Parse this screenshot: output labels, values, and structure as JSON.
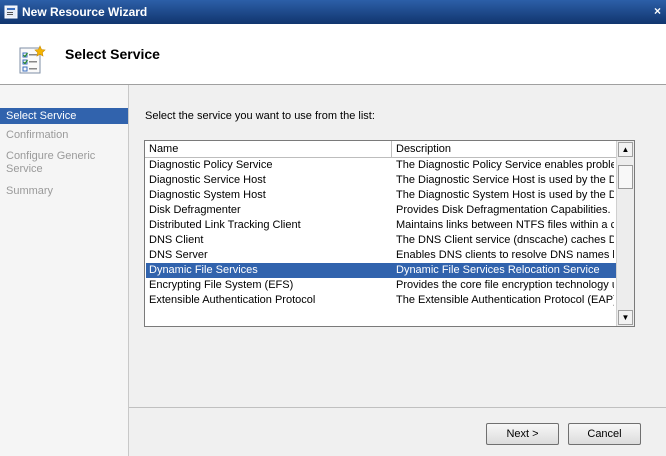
{
  "window": {
    "title": "New Resource Wizard",
    "close_label": "×"
  },
  "header": {
    "title": "Select Service"
  },
  "nav": {
    "items": [
      {
        "label": "Select Service",
        "active": true
      },
      {
        "label": "Confirmation",
        "active": false
      },
      {
        "label": "Configure Generic Service",
        "active": false
      },
      {
        "label": "Summary",
        "active": false
      }
    ]
  },
  "main": {
    "instruction": "Select the service you want to use from the list:",
    "columns": {
      "name": "Name",
      "description": "Description"
    },
    "services": [
      {
        "name": "Diagnostic Policy Service",
        "description": "The Diagnostic Policy Service enables problem ..."
      },
      {
        "name": "Diagnostic Service Host",
        "description": "The Diagnostic Service Host is used by the Dia..."
      },
      {
        "name": "Diagnostic System Host",
        "description": "The Diagnostic System Host is used by the Diag..."
      },
      {
        "name": "Disk Defragmenter",
        "description": "Provides Disk Defragmentation Capabilities."
      },
      {
        "name": "Distributed Link Tracking Client",
        "description": "Maintains links between NTFS files within a com..."
      },
      {
        "name": "DNS Client",
        "description": "The DNS Client service (dnscache) caches Do..."
      },
      {
        "name": "DNS Server",
        "description": "Enables DNS clients to resolve DNS names by ..."
      },
      {
        "name": "Dynamic File Services",
        "description": "Dynamic File Services Relocation Service"
      },
      {
        "name": "Encrypting File System (EFS)",
        "description": "Provides the core file encryption technology use..."
      },
      {
        "name": "Extensible Authentication Protocol",
        "description": "The Extensible Authentication Protocol (EAP) se..."
      }
    ],
    "selected_index": 7
  },
  "buttons": {
    "next": "Next >",
    "cancel": "Cancel"
  },
  "icons": {
    "app": "wizard-window-icon",
    "header": "service-wizard-icon",
    "scroll_up": "arrow-up-icon",
    "scroll_down": "arrow-down-icon"
  },
  "colors": {
    "selection": "#3163ad",
    "titlebar": "#1f4a8c"
  }
}
